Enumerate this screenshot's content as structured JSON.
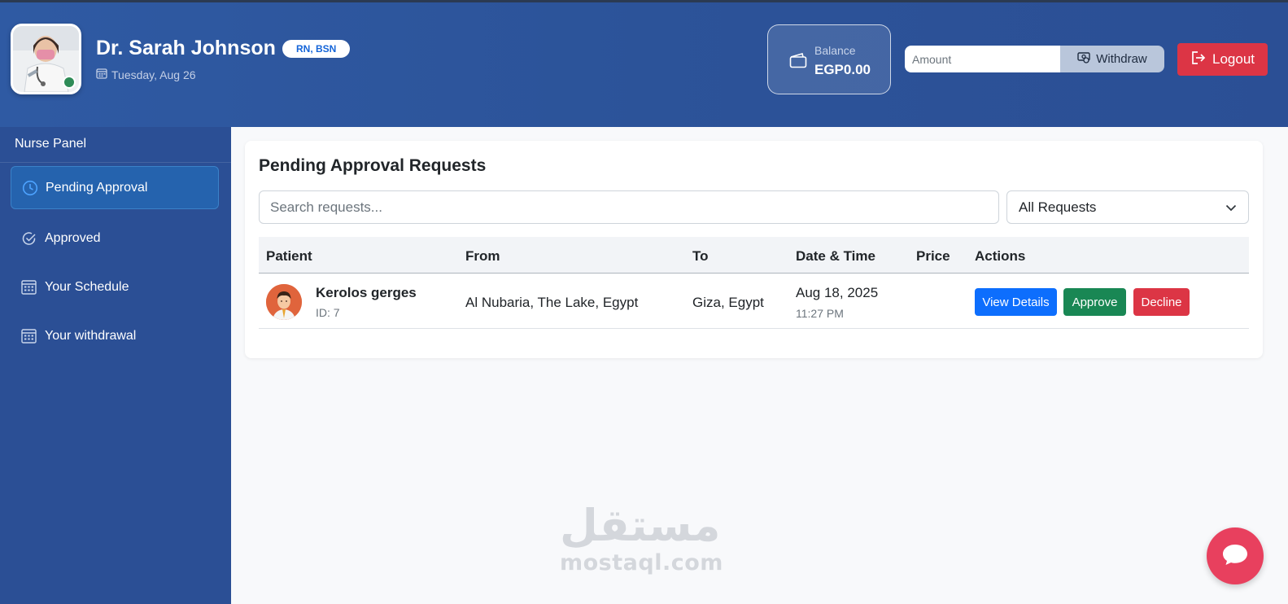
{
  "header": {
    "doctor_name": "Dr. Sarah Johnson",
    "credentials": "RN, BSN",
    "date": "Tuesday, Aug 26",
    "balance_label": "Balance",
    "balance_value": "EGP0.00",
    "amount_placeholder": "Amount",
    "withdraw_label": "Withdraw",
    "logout_label": "Logout"
  },
  "sidebar": {
    "title": "Nurse Panel",
    "items": [
      {
        "label": "Pending Approval",
        "icon": "clock-icon",
        "active": true
      },
      {
        "label": "Approved",
        "icon": "check-circle-icon",
        "active": false
      },
      {
        "label": "Your Schedule",
        "icon": "calendar-icon",
        "active": false
      },
      {
        "label": "Your withdrawal",
        "icon": "calendar-icon",
        "active": false
      }
    ]
  },
  "main": {
    "title": "Pending Approval Requests",
    "search_placeholder": "Search requests...",
    "filter_selected": "All Requests",
    "columns": [
      "Patient",
      "From",
      "To",
      "Date & Time",
      "Price",
      "Actions"
    ],
    "rows": [
      {
        "patient_name": "Kerolos gerges",
        "patient_id": "ID: 7",
        "from": "Al Nubaria, The Lake, Egypt",
        "to": "Giza, Egypt",
        "date": "Aug 18, 2025",
        "time": "11:27 PM",
        "price": "",
        "actions": {
          "view": "View Details",
          "approve": "Approve",
          "decline": "Decline"
        }
      }
    ]
  },
  "watermark": {
    "arabic": "مستقل",
    "latin": "mostaql.com"
  },
  "colors": {
    "header_bg": "#2c5399",
    "sidebar_bg": "#2b4f95",
    "primary": "#0d6efd",
    "success": "#198754",
    "danger": "#dc3545",
    "chat": "#e8405e"
  }
}
